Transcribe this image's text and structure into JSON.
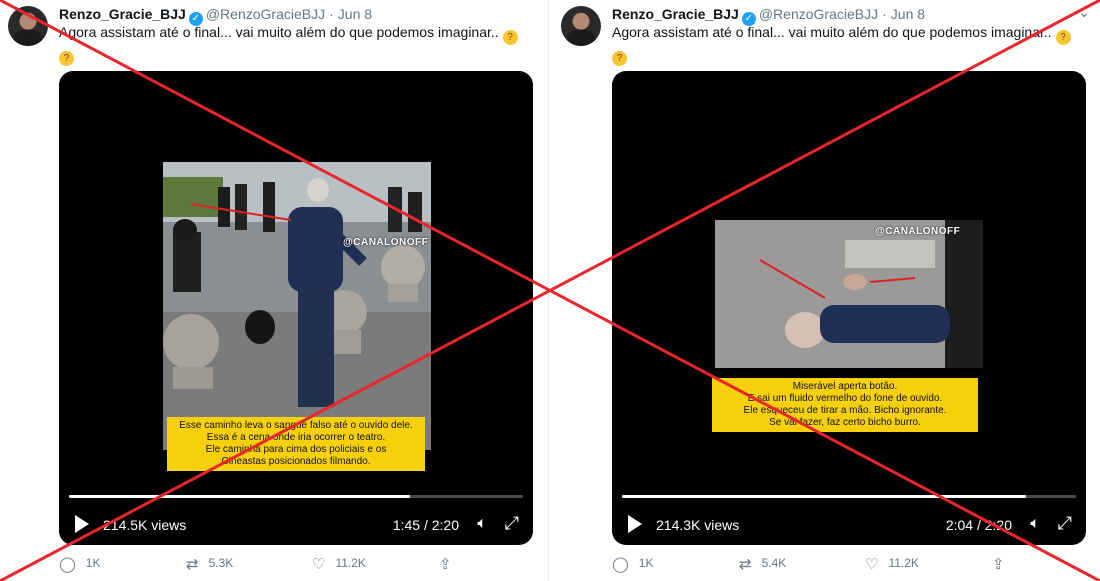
{
  "tweets": [
    {
      "name": "Renzo_Gracie_BJJ",
      "handle": "@RenzoGracieBJJ",
      "date": "Jun 8",
      "text": "Agora assistam até o final... vai muito além do que podemos imaginar..",
      "video": {
        "watermark": "@CANALONOFF",
        "caption": [
          "Esse caminho leva o sangue falso até o ouvido dele.",
          "Essa é a cena onde iria ocorrer o teatro.",
          "Ele caminha para cima dos policiais e os",
          "Cineastas posicionados filmando."
        ],
        "views": "214.5K views",
        "time": "1:45 / 2:20",
        "progress": 0.75
      },
      "actions": {
        "reply": "1K",
        "retweet": "5.3K",
        "like": "11.2K"
      }
    },
    {
      "name": "Renzo_Gracie_BJJ",
      "handle": "@RenzoGracieBJJ",
      "date": "Jun 8",
      "text": "Agora assistam até o final... vai muito além do que podemos imaginar..",
      "video": {
        "watermark": "@CANALONOFF",
        "caption": [
          "Miserável aperta botão.",
          "E sai um fluido vermelho do fone de ouvido.",
          "Ele esqueceu de tirar a mão. Bicho ignorante.",
          "Se vai fazer, faz certo bicho burro."
        ],
        "views": "214.3K views",
        "time": "2:04 / 2:20",
        "progress": 0.89
      },
      "actions": {
        "reply": "1K",
        "retweet": "5.4K",
        "like": "11.2K"
      }
    }
  ],
  "icons": {
    "verified": "verified-badge-icon",
    "reply": "reply-icon",
    "retweet": "retweet-icon",
    "like": "like-icon",
    "share": "share-icon",
    "play": "play-icon",
    "volume": "volume-icon",
    "fullscreen": "fullscreen-icon"
  },
  "colors": {
    "overlay_x": "#e8262b",
    "verified": "#1da1f2",
    "caption_bg": "#f6d00c"
  }
}
